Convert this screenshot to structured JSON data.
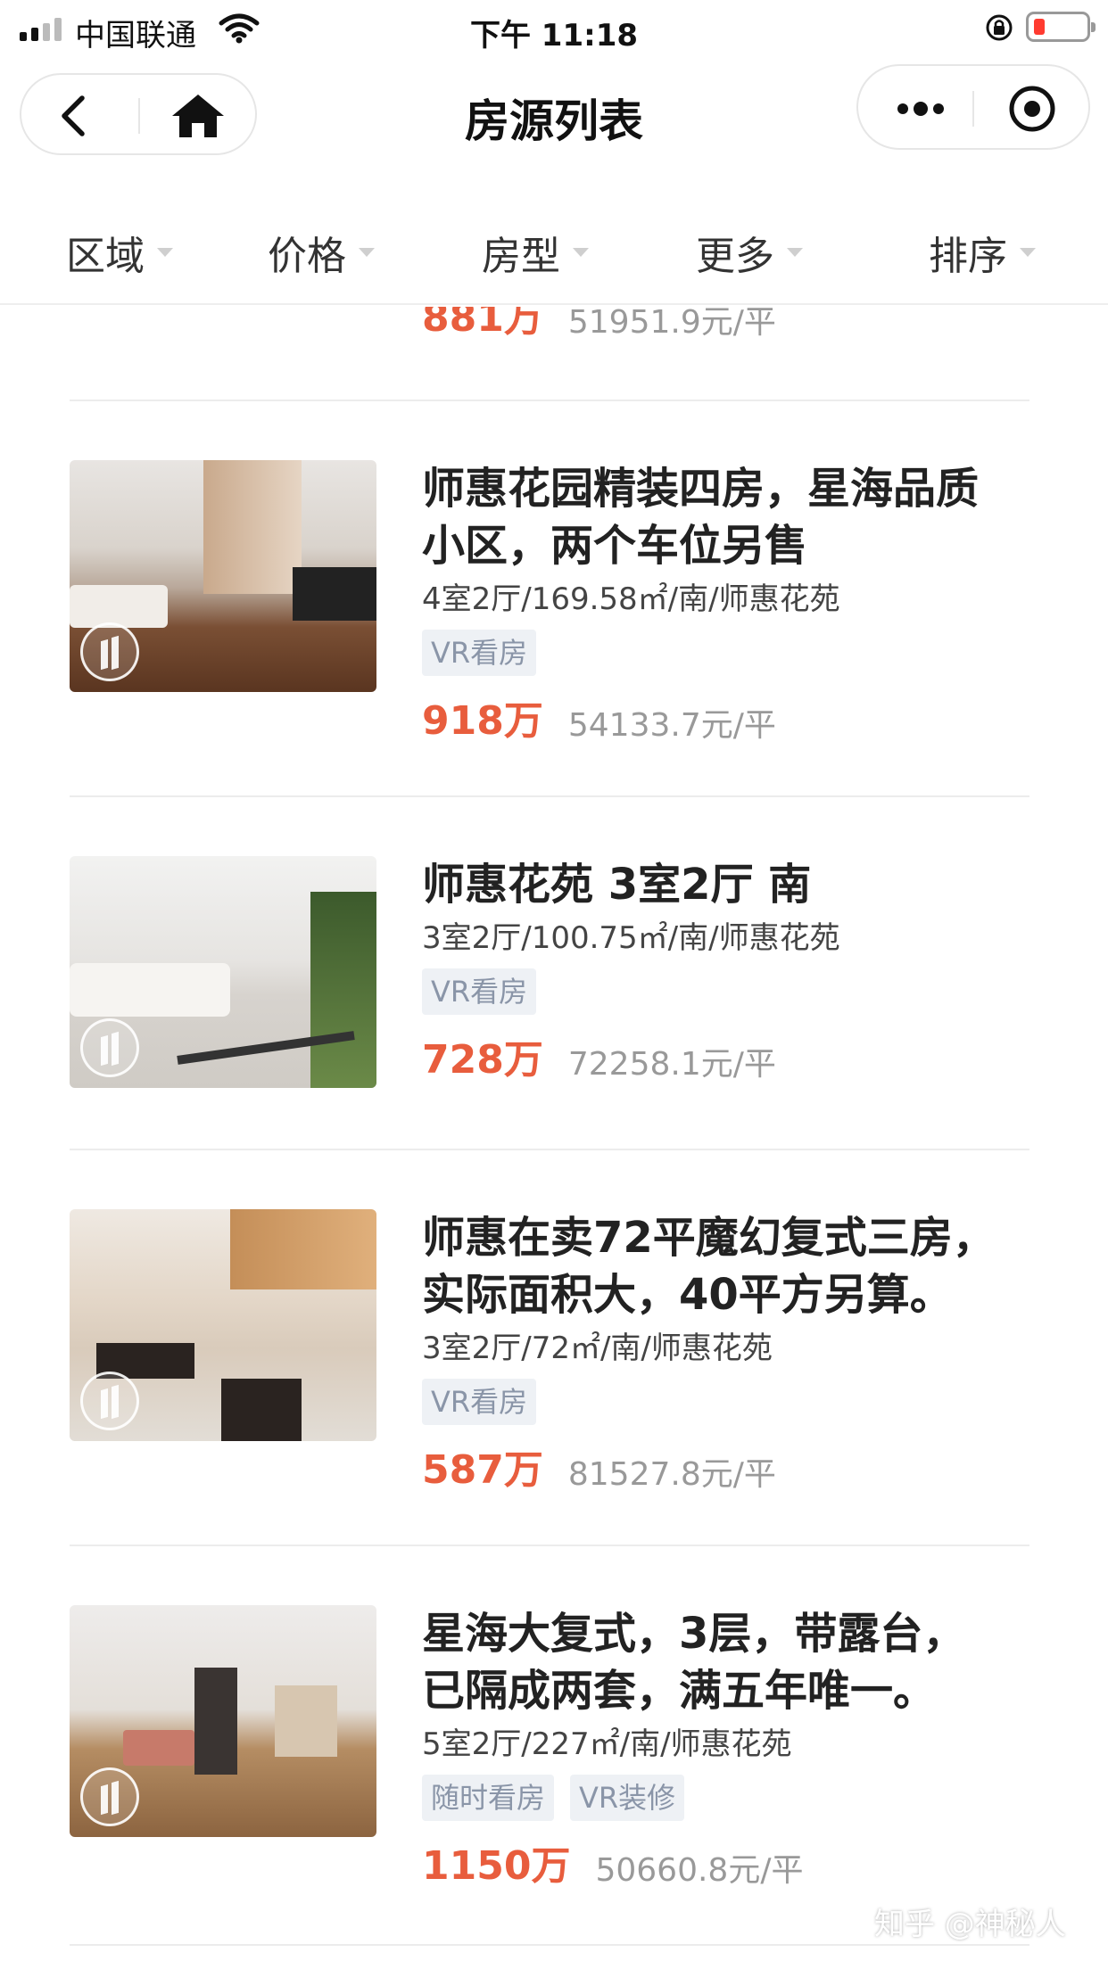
{
  "status": {
    "carrier": "中国联通",
    "time": "下午 11:18"
  },
  "nav": {
    "title": "房源列表",
    "back_icon": "chevron-left-icon",
    "home_icon": "home-icon",
    "more_icon": "more-dots-icon",
    "close_icon": "target-circle-icon"
  },
  "filters": [
    {
      "label": "区域"
    },
    {
      "label": "价格"
    },
    {
      "label": "房型"
    },
    {
      "label": "更多"
    },
    {
      "label": "排序"
    }
  ],
  "partial": {
    "price": "881万",
    "unit_price": "51951.9元/平"
  },
  "listings": [
    {
      "title_line1": "师惠花园精装四房，星海品质",
      "title_line2": "小区，两个车位另售",
      "meta": "4室2厅/169.58㎡/南/师惠花苑",
      "tags": [
        "VR看房"
      ],
      "price": "918万",
      "unit_price": "54133.7元/平"
    },
    {
      "title_line1": "师惠花苑 3室2厅 南",
      "title_line2": "",
      "meta": "3室2厅/100.75㎡/南/师惠花苑",
      "tags": [
        "VR看房"
      ],
      "price": "728万",
      "unit_price": "72258.1元/平"
    },
    {
      "title_line1": "师惠在卖72平魔幻复式三房，",
      "title_line2": "实际面积大，40平方另算。",
      "meta": "3室2厅/72㎡/南/师惠花苑",
      "tags": [
        "VR看房"
      ],
      "price": "587万",
      "unit_price": "81527.8元/平"
    },
    {
      "title_line1": "星海大复式，3层，带露台，",
      "title_line2": "已隔成两套，满五年唯一。",
      "meta": "5室2厅/227㎡/南/师惠花苑",
      "tags": [
        "随时看房",
        "VR装修"
      ],
      "price": "1150万",
      "unit_price": "50660.8元/平"
    }
  ],
  "watermark": "知乎 @神秘人",
  "colors": {
    "price": "#e85d3d",
    "tag_text": "#8a95a8",
    "tag_bg": "#eef1f5"
  }
}
